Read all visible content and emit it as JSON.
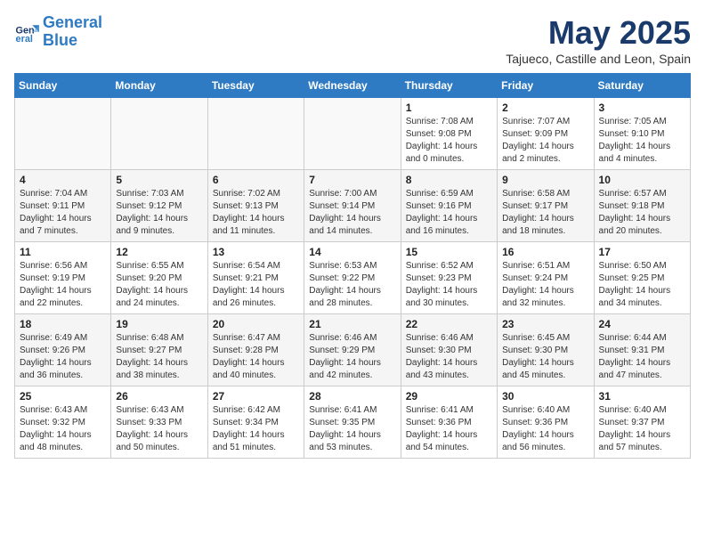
{
  "header": {
    "logo_line1": "General",
    "logo_line2": "Blue",
    "title": "May 2025",
    "subtitle": "Tajueco, Castille and Leon, Spain"
  },
  "weekdays": [
    "Sunday",
    "Monday",
    "Tuesday",
    "Wednesday",
    "Thursday",
    "Friday",
    "Saturday"
  ],
  "weeks": [
    [
      {
        "day": "",
        "info": ""
      },
      {
        "day": "",
        "info": ""
      },
      {
        "day": "",
        "info": ""
      },
      {
        "day": "",
        "info": ""
      },
      {
        "day": "1",
        "info": "Sunrise: 7:08 AM\nSunset: 9:08 PM\nDaylight: 14 hours and 0 minutes."
      },
      {
        "day": "2",
        "info": "Sunrise: 7:07 AM\nSunset: 9:09 PM\nDaylight: 14 hours and 2 minutes."
      },
      {
        "day": "3",
        "info": "Sunrise: 7:05 AM\nSunset: 9:10 PM\nDaylight: 14 hours and 4 minutes."
      }
    ],
    [
      {
        "day": "4",
        "info": "Sunrise: 7:04 AM\nSunset: 9:11 PM\nDaylight: 14 hours and 7 minutes."
      },
      {
        "day": "5",
        "info": "Sunrise: 7:03 AM\nSunset: 9:12 PM\nDaylight: 14 hours and 9 minutes."
      },
      {
        "day": "6",
        "info": "Sunrise: 7:02 AM\nSunset: 9:13 PM\nDaylight: 14 hours and 11 minutes."
      },
      {
        "day": "7",
        "info": "Sunrise: 7:00 AM\nSunset: 9:14 PM\nDaylight: 14 hours and 14 minutes."
      },
      {
        "day": "8",
        "info": "Sunrise: 6:59 AM\nSunset: 9:16 PM\nDaylight: 14 hours and 16 minutes."
      },
      {
        "day": "9",
        "info": "Sunrise: 6:58 AM\nSunset: 9:17 PM\nDaylight: 14 hours and 18 minutes."
      },
      {
        "day": "10",
        "info": "Sunrise: 6:57 AM\nSunset: 9:18 PM\nDaylight: 14 hours and 20 minutes."
      }
    ],
    [
      {
        "day": "11",
        "info": "Sunrise: 6:56 AM\nSunset: 9:19 PM\nDaylight: 14 hours and 22 minutes."
      },
      {
        "day": "12",
        "info": "Sunrise: 6:55 AM\nSunset: 9:20 PM\nDaylight: 14 hours and 24 minutes."
      },
      {
        "day": "13",
        "info": "Sunrise: 6:54 AM\nSunset: 9:21 PM\nDaylight: 14 hours and 26 minutes."
      },
      {
        "day": "14",
        "info": "Sunrise: 6:53 AM\nSunset: 9:22 PM\nDaylight: 14 hours and 28 minutes."
      },
      {
        "day": "15",
        "info": "Sunrise: 6:52 AM\nSunset: 9:23 PM\nDaylight: 14 hours and 30 minutes."
      },
      {
        "day": "16",
        "info": "Sunrise: 6:51 AM\nSunset: 9:24 PM\nDaylight: 14 hours and 32 minutes."
      },
      {
        "day": "17",
        "info": "Sunrise: 6:50 AM\nSunset: 9:25 PM\nDaylight: 14 hours and 34 minutes."
      }
    ],
    [
      {
        "day": "18",
        "info": "Sunrise: 6:49 AM\nSunset: 9:26 PM\nDaylight: 14 hours and 36 minutes."
      },
      {
        "day": "19",
        "info": "Sunrise: 6:48 AM\nSunset: 9:27 PM\nDaylight: 14 hours and 38 minutes."
      },
      {
        "day": "20",
        "info": "Sunrise: 6:47 AM\nSunset: 9:28 PM\nDaylight: 14 hours and 40 minutes."
      },
      {
        "day": "21",
        "info": "Sunrise: 6:46 AM\nSunset: 9:29 PM\nDaylight: 14 hours and 42 minutes."
      },
      {
        "day": "22",
        "info": "Sunrise: 6:46 AM\nSunset: 9:30 PM\nDaylight: 14 hours and 43 minutes."
      },
      {
        "day": "23",
        "info": "Sunrise: 6:45 AM\nSunset: 9:30 PM\nDaylight: 14 hours and 45 minutes."
      },
      {
        "day": "24",
        "info": "Sunrise: 6:44 AM\nSunset: 9:31 PM\nDaylight: 14 hours and 47 minutes."
      }
    ],
    [
      {
        "day": "25",
        "info": "Sunrise: 6:43 AM\nSunset: 9:32 PM\nDaylight: 14 hours and 48 minutes."
      },
      {
        "day": "26",
        "info": "Sunrise: 6:43 AM\nSunset: 9:33 PM\nDaylight: 14 hours and 50 minutes."
      },
      {
        "day": "27",
        "info": "Sunrise: 6:42 AM\nSunset: 9:34 PM\nDaylight: 14 hours and 51 minutes."
      },
      {
        "day": "28",
        "info": "Sunrise: 6:41 AM\nSunset: 9:35 PM\nDaylight: 14 hours and 53 minutes."
      },
      {
        "day": "29",
        "info": "Sunrise: 6:41 AM\nSunset: 9:36 PM\nDaylight: 14 hours and 54 minutes."
      },
      {
        "day": "30",
        "info": "Sunrise: 6:40 AM\nSunset: 9:36 PM\nDaylight: 14 hours and 56 minutes."
      },
      {
        "day": "31",
        "info": "Sunrise: 6:40 AM\nSunset: 9:37 PM\nDaylight: 14 hours and 57 minutes."
      }
    ]
  ]
}
